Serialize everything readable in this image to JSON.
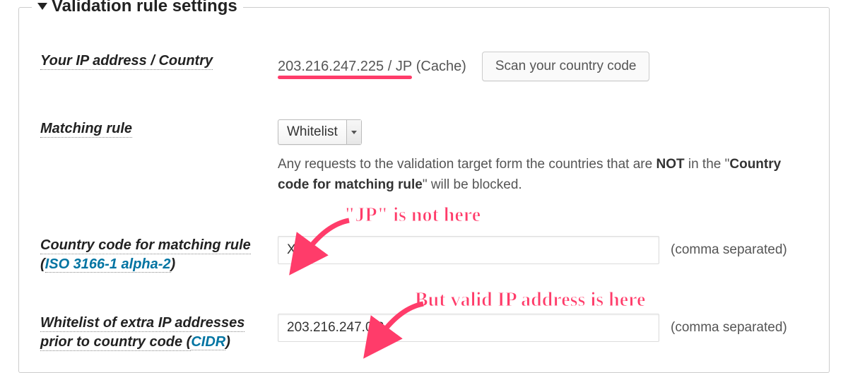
{
  "section_title": "Validation rule settings",
  "labels": {
    "ip_country": "Your IP address / Country",
    "matching_rule": "Matching rule",
    "country_code_rule_line1": "Country code for matching rule",
    "country_code_rule_line2_prefix": "(",
    "iso_link_text": "ISO 3166-1 alpha-2",
    "country_code_rule_line2_suffix": ")",
    "whitelist_line1": "Whitelist of extra IP addresses",
    "whitelist_line2_prefix": "prior to country code (",
    "cidr_link_text": "CIDR",
    "whitelist_line2_suffix": ")"
  },
  "ip_info": {
    "ip_country_text": "203.216.247.225 / JP",
    "cache_suffix": " (Cache)",
    "scan_button": "Scan your country code"
  },
  "matching": {
    "selected": "Whitelist",
    "desc_prefix": "Any requests to the validation target form the countries that are ",
    "desc_not": "NOT",
    "desc_mid": " in the \"",
    "desc_bold": "Country code for matching rule",
    "desc_suffix": "\" will be blocked."
  },
  "country_code_input": "XX",
  "whitelist_input": "203.216.247.0/8",
  "suffix_text": "(comma separated)",
  "callouts": {
    "jp_not_here": "\"JP\" is not here",
    "valid_ip_here": "But valid IP address is here"
  }
}
